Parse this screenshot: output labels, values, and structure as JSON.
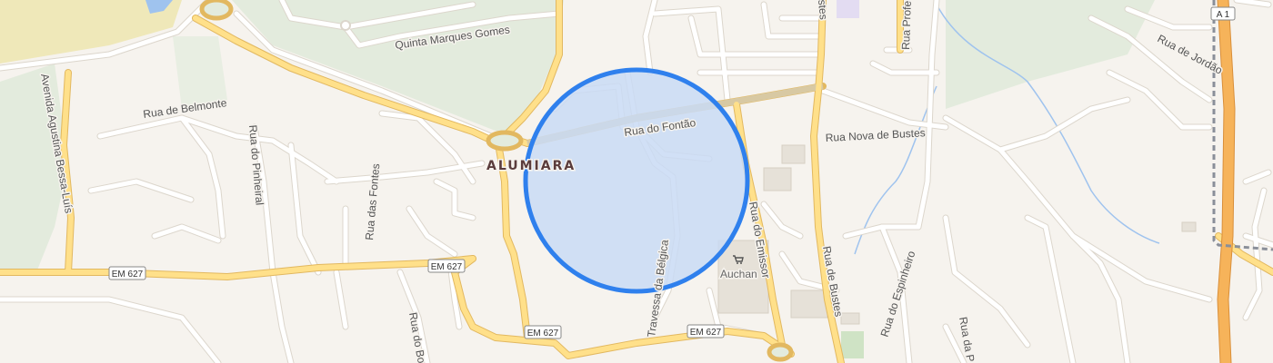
{
  "map": {
    "place_label": "ALUMIARA",
    "streets": {
      "quinta": "Quinta Marques Gomes",
      "avenida": "Avenida Agustina Bessa-Luís",
      "belmonte": "Rua de Belmonte",
      "pinheiral": "Rua do Pinheiral",
      "fontes": "Rua das Fontes",
      "fontao": "Rua do Fontão",
      "belgica": "Travessa da Bélgica",
      "emissor": "Rua do Emissor",
      "bustes": "Rua de Bustes",
      "nova_bustes": "Rua Nova de Bustes",
      "espinheiro": "Rua do Espinheiro",
      "jordao": "Rua de Jordão",
      "profe": "Rua Profe",
      "bo": "Rua do Bo",
      "rua_da_p": "Rua da P",
      "bustes_top": "stes"
    },
    "shields": {
      "em627_a": "EM 627",
      "em627_b": "EM 627",
      "em627_c": "EM 627",
      "em627_d": "EM 627",
      "a1": "A 1"
    },
    "poi": {
      "name": "Auchan",
      "icon": "shopping-cart-icon"
    },
    "location_circle": {
      "fill": "#c9dbf4",
      "stroke": "#2f80ed"
    },
    "colors": {
      "background": "#f6f3ee",
      "park": "#e3ebdd",
      "major_road": "#ffe08a",
      "motorway": "#f6b35a"
    }
  }
}
